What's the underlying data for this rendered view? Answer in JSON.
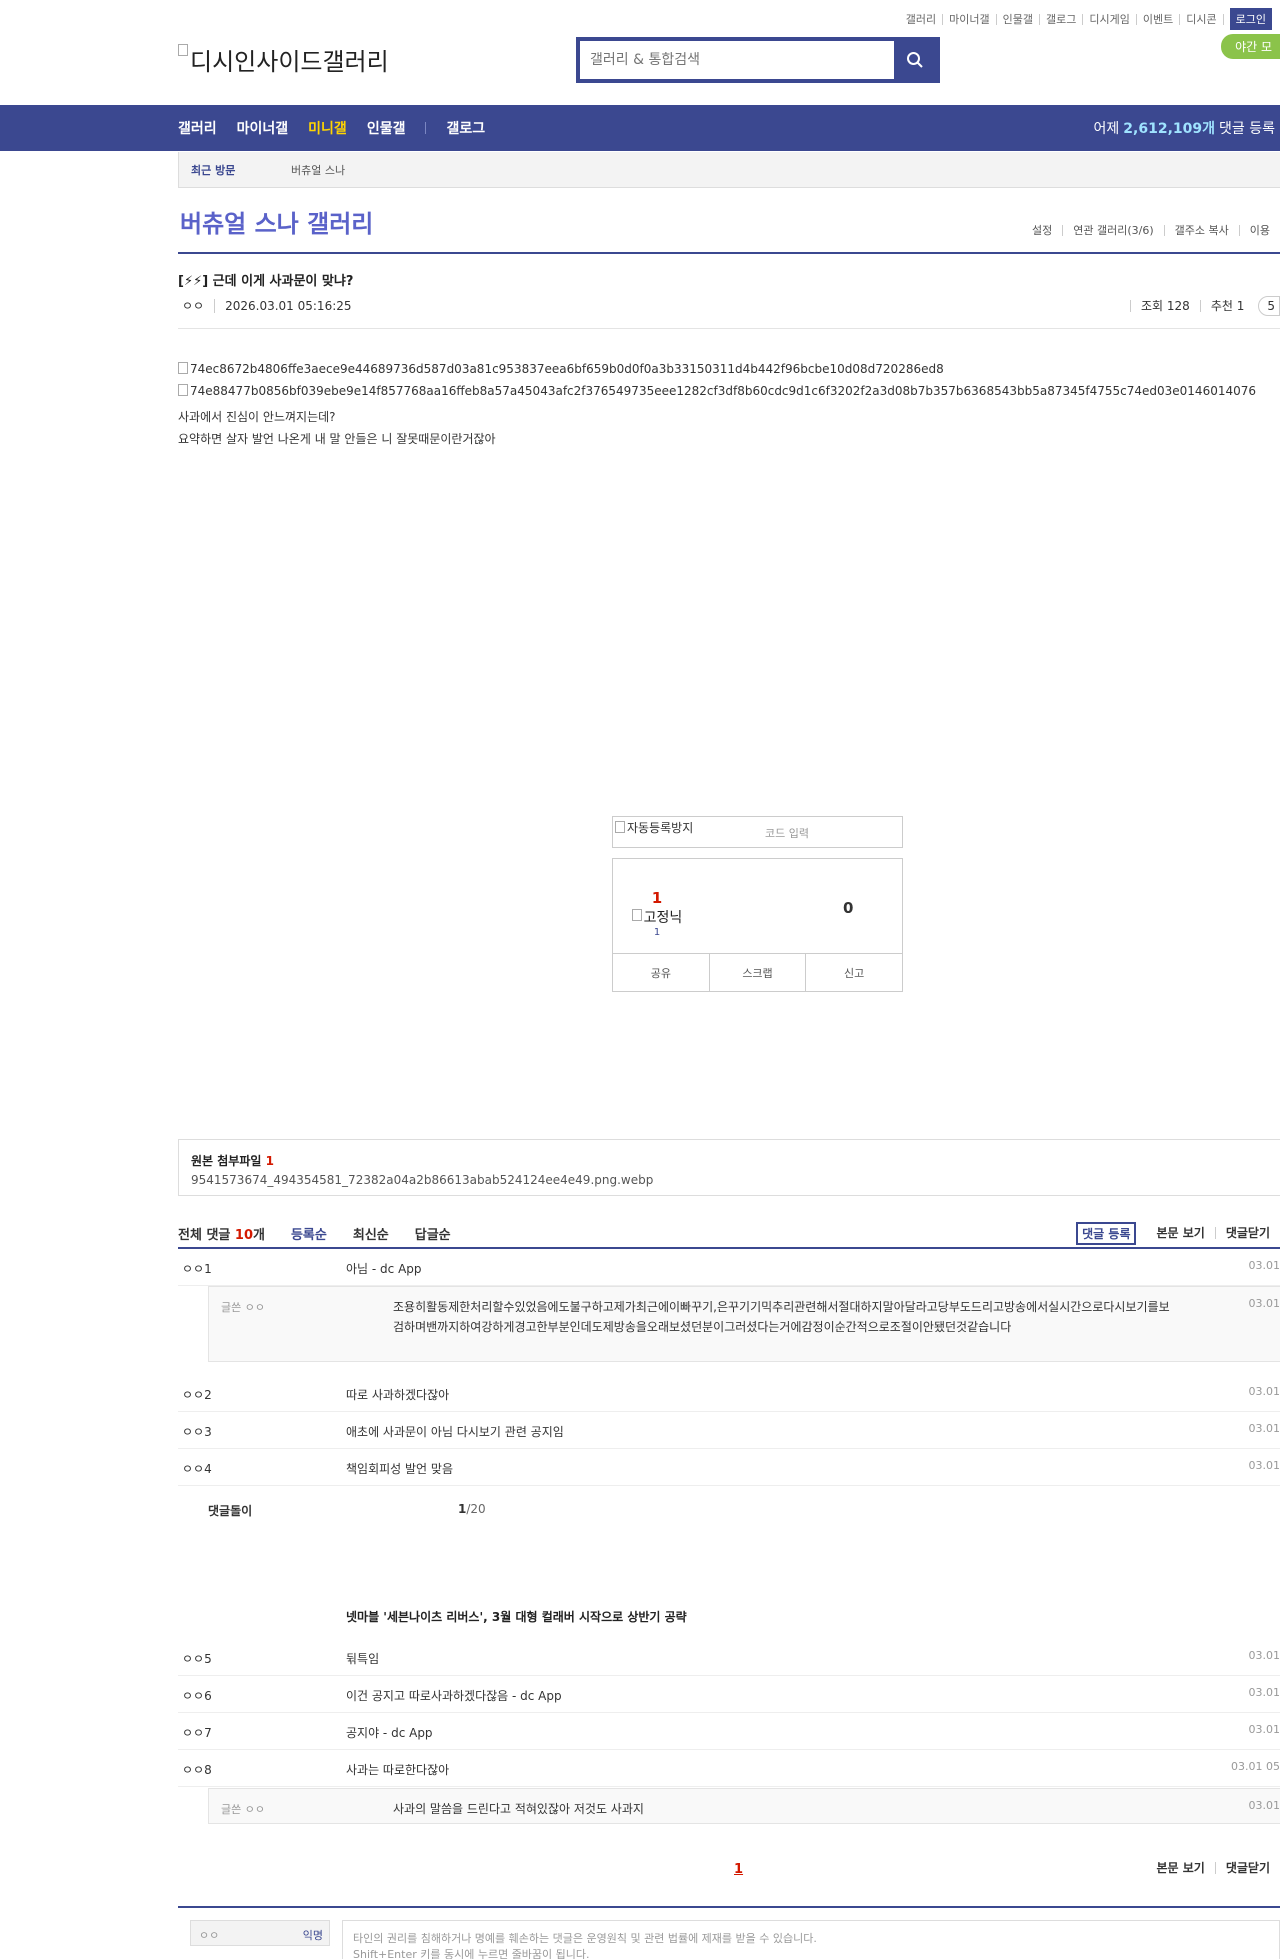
{
  "header": {
    "logo_alt": "디시인사이드갤러리",
    "util_nav": [
      "갤러리",
      "마이너갤",
      "인물갤",
      "갤로그",
      "디시게임",
      "이벤트",
      "디시콘"
    ],
    "login_label": "로그인",
    "night_label": "야간 모",
    "search_placeholder": "갤러리 & 통합검색"
  },
  "gnb": {
    "items": [
      "갤러리",
      "마이너갤",
      "미니갤",
      "인물갤",
      "갤로그"
    ],
    "stat_prefix": "어제",
    "stat_num": "2,612,109개",
    "stat_suffix": "댓글 등록"
  },
  "visit": {
    "title": "최근 방문",
    "item": "버츄얼 스나"
  },
  "gallery": {
    "title": "버츄얼 스나 갤러리",
    "options": [
      "설정",
      "연관 갤러리(3/6)",
      "갤주소 복사",
      "이용"
    ]
  },
  "post": {
    "subject": "[⚡⚡] 근데 이게 사과문이 맞냐?",
    "author": "ㅇㅇ",
    "date": "2026.03.01 05:16:25",
    "views": "조회 128",
    "recommend": "추천 1",
    "pill": "5",
    "image1_alt": "74ec8672b4806ffe3aece9e44689736d587d03a81c953837eea6bf659b0d0f0a3b33150311d4b442f96bcbe10d08d720286ed8",
    "image2_alt": "74e88477b0856bf039ebe9e14f857768aa16ffeb8a57a45043afc2f376549735eee1282cf3df8b60cdc9d1c6f3202f2a3d08b7b357b6368543bb5a87345f4755c74ed03e0146014076",
    "para1": "사과에서 진심이 안느껴지는데?",
    "para2": "요약하면 살자 발언 나온게 내 말 안들은 니 잘못때문이란거잖아"
  },
  "captcha": {
    "img_alt": "자동등록방지",
    "input_placeholder": "코드 입력"
  },
  "vote": {
    "up_count": "1",
    "fixed_alt": "고정닉",
    "fixed_count": "1",
    "down_count": "0",
    "actions": [
      "공유",
      "스크랩",
      "신고"
    ]
  },
  "attach": {
    "title": "원본 첨부파일",
    "count": "1",
    "file": "9541573674_494354581_72382a04a2b86613abab524124ee4e49.png.webp"
  },
  "comments": {
    "total_label": "전체 댓글",
    "total_count": "10",
    "total_unit": "개",
    "sorts": [
      "등록순",
      "최신순",
      "답글순"
    ],
    "register_label": "댓글 등록",
    "view_body": "본문 보기",
    "close_label": "댓글닫기",
    "rows": [
      {
        "nick": "ㅇㅇ1",
        "text": "아님 - dc App",
        "date": "03.01"
      },
      {
        "nick": "ㅇㅇ2",
        "text": "따로 사과하겠다잖아",
        "date": "03.01"
      },
      {
        "nick": "ㅇㅇ3",
        "text": "애초에 사과문이 아님 다시보기 관련 공지임",
        "date": "03.01"
      },
      {
        "nick": "ㅇㅇ4",
        "text": "책임회피성 발언 맞음",
        "date": "03.01"
      },
      {
        "nick": "ㅇㅇ5",
        "text": "뒦특임",
        "date": "03.01"
      },
      {
        "nick": "ㅇㅇ6",
        "text": "이건 공지고 따로사과하겠다잖음 - dc App",
        "date": "03.01"
      },
      {
        "nick": "ㅇㅇ7",
        "text": "공지야 - dc App",
        "date": "03.01"
      },
      {
        "nick": "ㅇㅇ8",
        "text": "사과는 따로한다잖아",
        "date": "03.01 05"
      }
    ],
    "reply1": {
      "nick": "글쓴 ㅇㅇ",
      "text": "조용히활동제한처리할수있었음에도불구하고제가최근에이빠꾸기,은꾸기기믹추리관련해서절대하지말아달라고당부도드리고방송에서실시간으로다시보기를보검하며밴까지하여강하게경고한부분인데도제방송을오래보셨던분이그러셨다는거에감정이순간적으로조절이안됐던것같습니다",
      "date": "03.01"
    },
    "reply2": {
      "nick": "글쓴 ㅇㅇ",
      "text": "사과의 말씀을 드린다고 적혀있잖아 저것도 사과지",
      "date": "03.01"
    },
    "pager_label": "댓글돌이",
    "pager_current": "1",
    "pager_total": "/20",
    "ad_headline": "넷마블 '세븐나이츠 리버스', 3월 대형 컬래버 시작으로 상반기 공략",
    "page": "1"
  },
  "write": {
    "nick": "ㅇㅇ",
    "anon": "익명",
    "placeholder": "타인의 권리를 침해하거나 명예를 훼손하는 댓글은 운영원칙 및 관련 법률에 제재를 받을 수 있습니다.",
    "placeholder2": "Shift+Enter 키를 동시에 누르면 줄바꿈이 됩니다."
  }
}
